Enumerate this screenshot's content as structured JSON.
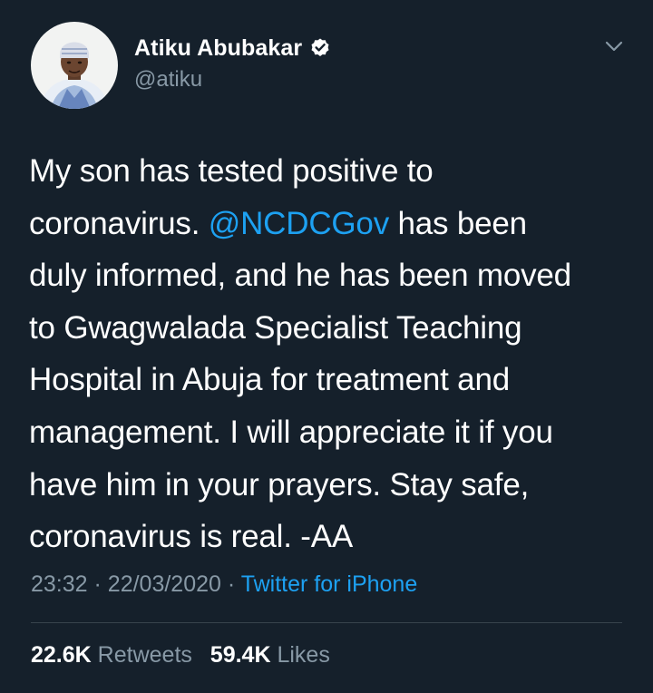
{
  "author": {
    "display_name": "Atiku Abubakar",
    "handle": "@atiku",
    "verified": true,
    "verified_badge_icon": "verified-badge-icon"
  },
  "tweet": {
    "lines": [
      {
        "before": "My son has tested positive to",
        "mention": "",
        "after": ""
      },
      {
        "before": "coronavirus. ",
        "mention": "@NCDCGov",
        "after": " has been"
      },
      {
        "before": "duly informed, and he has been moved",
        "mention": "",
        "after": ""
      },
      {
        "before": "to Gwagwalada Specialist Teaching",
        "mention": "",
        "after": ""
      },
      {
        "before": "Hospital in Abuja for treatment and",
        "mention": "",
        "after": ""
      },
      {
        "before": "management. I will appreciate it if you",
        "mention": "",
        "after": ""
      },
      {
        "before": "have him in your prayers. Stay safe,",
        "mention": "",
        "after": ""
      },
      {
        "before": "coronavirus is real. -AA",
        "mention": "",
        "after": ""
      }
    ],
    "time": "23:32",
    "date": "22/03/2020",
    "separator": "·",
    "source": "Twitter for iPhone"
  },
  "stats": {
    "retweets_count": "22.6K",
    "retweets_label": "Retweets",
    "likes_count": "59.4K",
    "likes_label": "Likes"
  },
  "colors": {
    "background": "#15202b",
    "link": "#1da1f2",
    "secondary_text": "#8899a6",
    "divider": "#38444d"
  }
}
